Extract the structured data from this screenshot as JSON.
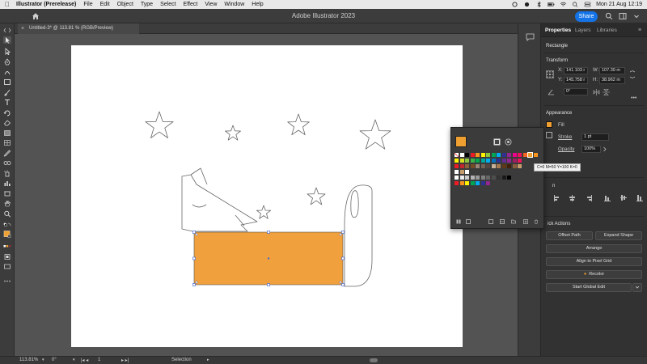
{
  "menubar": {
    "app_name": "Illustrator (Prerelease)",
    "items": [
      "File",
      "Edit",
      "Object",
      "Type",
      "Select",
      "Effect",
      "View",
      "Window",
      "Help"
    ],
    "clock": "Mon 21 Aug  12:19"
  },
  "appbar": {
    "title": "Adobe Illustrator 2023",
    "share_label": "Share"
  },
  "document": {
    "tab_title": "Untitled-3* @ 113.81 % (RGB/Preview)",
    "close_glyph": "×"
  },
  "artwork": {
    "rectangle_fill": "#f0a03c",
    "selection_color": "#4a6cd4"
  },
  "swatches": {
    "fill_color": "#f0a030",
    "tooltip": "C=0 M=50 Y=100 K=0",
    "rows": [
      [
        "#ffffff",
        "#ffffff",
        "#000000",
        "#ed1c24",
        "#f7941d",
        "#fff200",
        "#8dc63f",
        "#00a651",
        "#00aeef",
        "#2e3192",
        "#92278f",
        "#ec008c",
        "#ed145b",
        "#f26522",
        "#f0a030",
        "#f7941d"
      ],
      [
        "#fff200",
        "#d7df23",
        "#8dc63f",
        "#39b54a",
        "#00a651",
        "#00a99d",
        "#00aeef",
        "#0072bc",
        "#2e3192",
        "#662d91",
        "#92278f",
        "#9e1f63",
        "#ed145b"
      ],
      [
        "#ec1c24",
        "#c1272d",
        "#8c6239",
        "#754c24",
        "#998675",
        "#736357",
        "#534741",
        "#c7b299",
        "#a67c52",
        "#603813",
        "#42210b",
        "#8b5e3c",
        "#c69c6d"
      ],
      [
        "#ffffff",
        "#c69c6d",
        "#ffffff"
      ],
      [
        "#ffffff",
        "#ececec",
        "#cccccc",
        "#b3b3b3",
        "#999999",
        "#808080",
        "#666666",
        "#4d4d4d",
        "#333333",
        "#1a1a1a",
        "#000000"
      ],
      [
        "#ed1c24",
        "#f7941d",
        "#fff200",
        "#00a651",
        "#00aeef",
        "#2e3192",
        "#92278f"
      ]
    ]
  },
  "properties": {
    "tabs": [
      "Properties",
      "Layers",
      "Libraries"
    ],
    "selection_type": "Rectangle",
    "transform_header": "Transform",
    "x_label": "X:",
    "x_value": "141.103 r",
    "y_label": "Y:",
    "y_value": "145.758 r",
    "w_label": "W:",
    "w_value": "107.39 m",
    "h_label": "H:",
    "h_value": "38.962 m",
    "rotation": "0°",
    "appearance_header": "Appearance",
    "fill_label": "Fill",
    "stroke_label": "Stroke",
    "stroke_value": "1 pt",
    "opacity_label": "Opacity",
    "opacity_value": "100%",
    "align_header_partial": "n",
    "quick_actions_header": "ick Actions",
    "offset_path": "Offset Path",
    "expand_shape": "Expand Shape",
    "arrange": "Arrange",
    "align_to_pixel_grid": "Align to Pixel Grid",
    "recolor": "Recolor",
    "start_global_edit": "Start Global Edit"
  },
  "statusbar": {
    "zoom": "113.81%",
    "rotation": "0°",
    "artboard_num": "1",
    "tool": "Selection"
  },
  "colors": {
    "accent": "#1473e6",
    "panel": "#323232",
    "canvas": "#535353"
  }
}
